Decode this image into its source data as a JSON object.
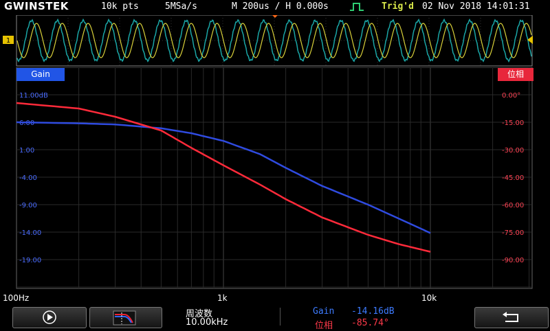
{
  "status": {
    "logo": "GWINSTEK",
    "record_length": "10k pts",
    "sample_rate": "5MSa/s",
    "timebase": "M 200us / H 0.000s",
    "trigger_status": "Trig'd",
    "datetime": "02 Nov 2018 14:01:31"
  },
  "channel": {
    "marker": "1"
  },
  "plot": {
    "gain_tab": "Gain",
    "phase_tab": "位相",
    "gain_ticks": [
      "11.00dB",
      "6.00",
      "1.00",
      "-4.00",
      "-9.00",
      "-14.00",
      "-19.00"
    ],
    "phase_ticks": [
      "0.00°",
      "-15.00",
      "-30.00",
      "-45.00",
      "-60.00",
      "-75.00",
      "-90.00"
    ],
    "x_ticks": [
      "100Hz",
      "1k",
      "10k"
    ]
  },
  "chart_data": {
    "type": "line",
    "x_scale": "log",
    "x_range_hz": [
      100,
      10000
    ],
    "y_left_range_db": [
      -24,
      11
    ],
    "y_right_range_deg": [
      -105,
      0
    ],
    "grid": true,
    "series": [
      {
        "name": "Gain",
        "color": "#2f4be0",
        "x": [
          100,
          200,
          300,
          500,
          700,
          1000,
          1500,
          2000,
          3000,
          5000,
          7000,
          10000
        ],
        "y": [
          6.0,
          5.8,
          5.6,
          4.9,
          4.0,
          2.6,
          0.2,
          -2.3,
          -5.6,
          -9.0,
          -11.5,
          -14.16
        ]
      },
      {
        "name": "位相",
        "color": "#ff2a3a",
        "x": [
          100,
          200,
          300,
          500,
          700,
          1000,
          1500,
          2000,
          3000,
          5000,
          7000,
          10000
        ],
        "y": [
          -4.5,
          -7.5,
          -12,
          -19.5,
          -29,
          -38.5,
          -49,
          -57,
          -67,
          -76.5,
          -81.5,
          -85.74
        ]
      }
    ]
  },
  "bottom": {
    "freq_label": "周波数",
    "freq_value": "10.00kHz",
    "gain_label": "Gain",
    "gain_value": "-14.16dB",
    "phase_label": "位相",
    "phase_value": "-85.74°"
  },
  "colors": {
    "gain": "#2155e6",
    "phase": "#e8273b",
    "ch1": "#d9d13a",
    "ch2": "#1aa6a6",
    "trigger": "#d9e84a"
  }
}
